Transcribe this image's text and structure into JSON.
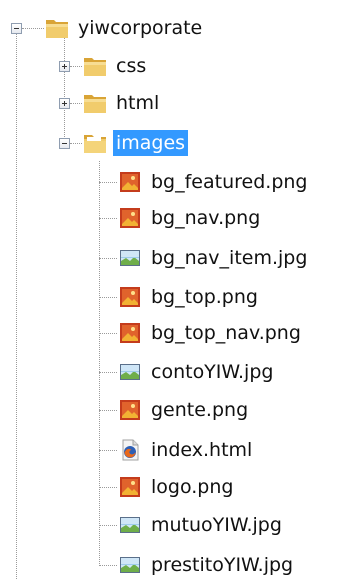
{
  "tree": {
    "root": {
      "label": "yiwcorporate",
      "expanded": true,
      "icon": "folder-icon"
    },
    "folders": [
      {
        "label": "css",
        "expanded": false,
        "icon": "folder-icon"
      },
      {
        "label": "html",
        "expanded": false,
        "icon": "folder-icon"
      },
      {
        "label": "images",
        "expanded": true,
        "selected": true,
        "icon": "folder-icon"
      }
    ],
    "files": [
      {
        "label": "bg_featured.png",
        "icon": "png-file-icon"
      },
      {
        "label": "bg_nav.png",
        "icon": "png-file-icon"
      },
      {
        "label": "bg_nav_item.jpg",
        "icon": "jpg-file-icon"
      },
      {
        "label": "bg_top.png",
        "icon": "png-file-icon"
      },
      {
        "label": "bg_top_nav.png",
        "icon": "png-file-icon"
      },
      {
        "label": "contoYIW.jpg",
        "icon": "jpg-file-icon"
      },
      {
        "label": "gente.png",
        "icon": "png-file-icon"
      },
      {
        "label": "index.html",
        "icon": "firefox-html-file-icon"
      },
      {
        "label": "logo.png",
        "icon": "png-file-icon"
      },
      {
        "label": "mutuoYIW.jpg",
        "icon": "jpg-file-icon"
      },
      {
        "label": "prestitoYIW.jpg",
        "icon": "jpg-file-icon"
      }
    ]
  },
  "colors": {
    "selection": "#3399ff",
    "folder": "#e8b84a",
    "connector": "#9a9a9a"
  }
}
